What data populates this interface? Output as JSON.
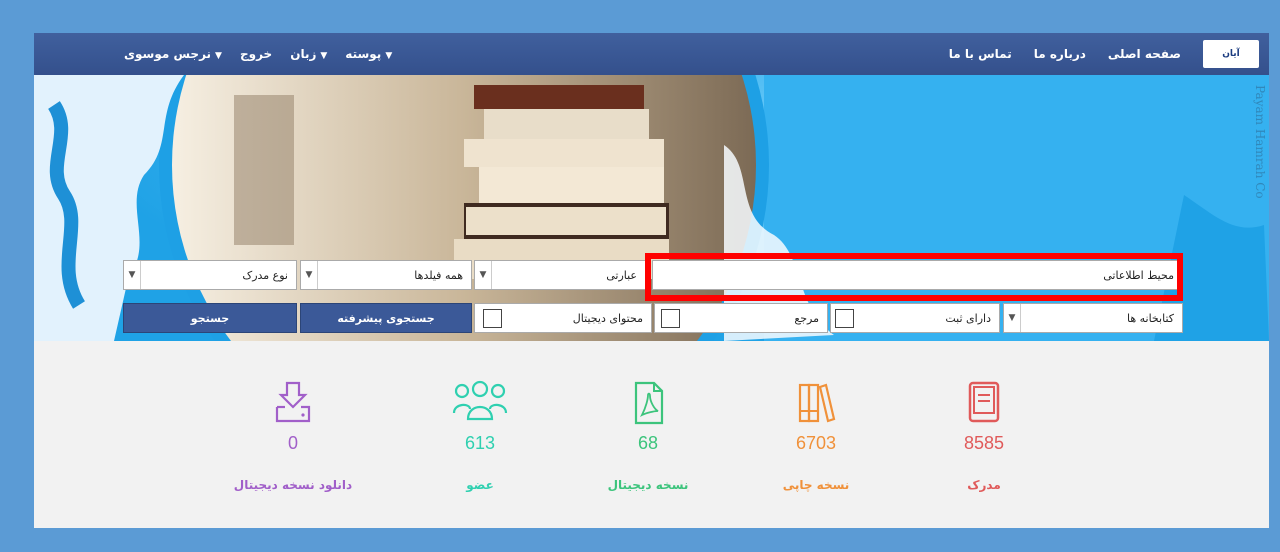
{
  "nav": {
    "brand": "آیان",
    "right_links": [
      "صفحه اصلی",
      "درباره ما",
      "تماس با ما"
    ],
    "left_links": [
      {
        "label": "نرجس موسوی",
        "has_caret": true
      },
      {
        "label": "خروج",
        "has_caret": false
      },
      {
        "label": "زبان",
        "has_caret": true
      },
      {
        "label": "پوسته",
        "has_caret": true
      }
    ]
  },
  "hero": {
    "side_caption": "Payam Hamrah Co"
  },
  "search": {
    "query_value": "محیط اطلاعاتی",
    "match_type": "عبارتی",
    "fields": "همه فیلدها",
    "doc_type": "نوع مدرک",
    "libraries": "کتابخانه ها",
    "has_record": "دارای ثبت",
    "reference_label": "مرجع",
    "digital_label": "محتوای دیجیتال",
    "advanced_label": "جستجوی پیشرفته",
    "search_label": "جستجو"
  },
  "stats": [
    {
      "value": "8585",
      "label": "مدرک",
      "color": "#e05a5a",
      "icon": "document-icon"
    },
    {
      "value": "6703",
      "label": "نسخه چاپی",
      "color": "#f0913a",
      "icon": "books-icon"
    },
    {
      "value": "68",
      "label": "نسخه دیجیتال",
      "color": "#3cc47c",
      "icon": "pdf-file-icon"
    },
    {
      "value": "613",
      "label": "عضو",
      "color": "#2fd0b0",
      "icon": "users-icon"
    },
    {
      "value": "0",
      "label": "دانلود نسخه دیجیتال",
      "color": "#a15fc9",
      "icon": "download-icon"
    }
  ]
}
